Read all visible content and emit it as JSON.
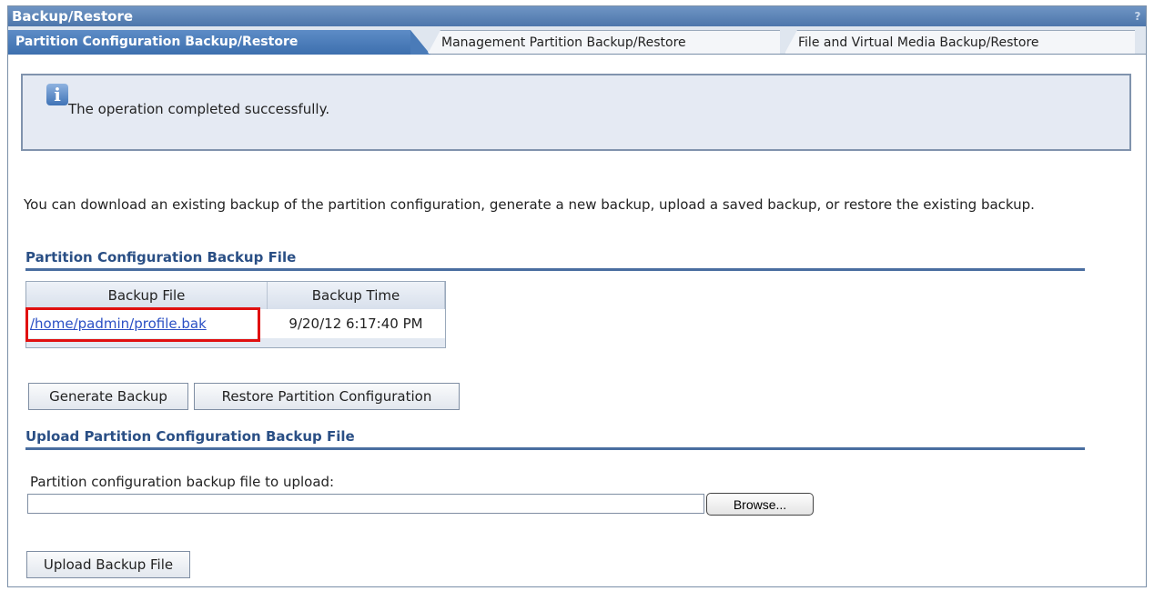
{
  "window": {
    "title": "Backup/Restore",
    "help_icon": "?"
  },
  "tabs": [
    {
      "label": "Partition Configuration Backup/Restore",
      "active": true
    },
    {
      "label": "Management Partition Backup/Restore",
      "active": false
    },
    {
      "label": "File and Virtual Media Backup/Restore",
      "active": false
    }
  ],
  "message": {
    "icon": "info-icon",
    "text": "The operation completed successfully."
  },
  "intro_text": "You can download an existing backup of the partition configuration, generate a new backup, upload a saved backup, or restore the existing backup.",
  "backup_section": {
    "title": "Partition Configuration Backup File",
    "columns": [
      "Backup File",
      "Backup Time"
    ],
    "rows": [
      {
        "file": "/home/padmin/profile.bak",
        "time": "9/20/12 6:17:40 PM"
      }
    ]
  },
  "buttons": {
    "generate": "Generate Backup",
    "restore": "Restore Partition Configuration"
  },
  "upload_section": {
    "title": "Upload Partition Configuration Backup File",
    "field_label": "Partition configuration backup file to upload:",
    "field_value": "",
    "browse_label": "Browse...",
    "upload_button": "Upload Backup File"
  },
  "colors": {
    "title_bar": "#4d76ab",
    "section_heading": "#2a4f85",
    "highlight": "#e01010",
    "link": "#2a4fc4"
  }
}
